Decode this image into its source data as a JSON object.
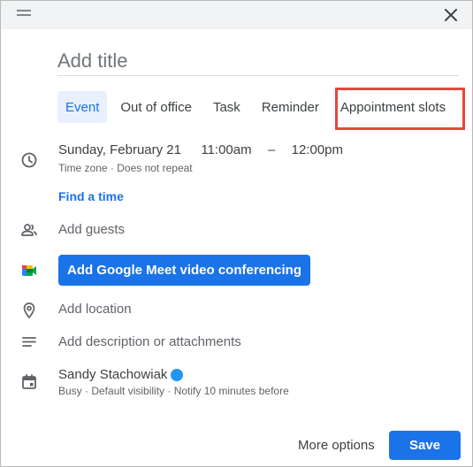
{
  "colors": {
    "accent": "#1a73e8",
    "highlight": "#e8463d",
    "calendar_dot": "#2196f3"
  },
  "header": {
    "drag_icon": "drag-handle-icon",
    "close_icon": "close-icon"
  },
  "title_input": {
    "placeholder": "Add title",
    "value": ""
  },
  "tabs": [
    {
      "label": "Event",
      "active": true
    },
    {
      "label": "Out of office",
      "active": false
    },
    {
      "label": "Task",
      "active": false
    },
    {
      "label": "Reminder",
      "active": false
    },
    {
      "label": "Appointment slots",
      "active": false
    }
  ],
  "datetime": {
    "date": "Sunday, February 21",
    "start": "11:00am",
    "separator": "–",
    "end": "12:00pm",
    "details": "Time zone · Does not repeat",
    "icon": "clock-icon"
  },
  "find_time": "Find a time",
  "guests": {
    "label": "Add guests",
    "icon": "people-icon"
  },
  "meet": {
    "label": "Add Google Meet video conferencing",
    "icon": "google-meet-icon"
  },
  "location": {
    "label": "Add location",
    "icon": "location-pin-icon"
  },
  "description": {
    "label": "Add description or attachments",
    "icon": "notes-icon"
  },
  "calendar": {
    "owner": "Sandy Stachowiak",
    "details": "Busy · Default visibility · Notify 10 minutes before",
    "icon": "calendar-icon"
  },
  "footer": {
    "more_options": "More options",
    "save": "Save"
  }
}
